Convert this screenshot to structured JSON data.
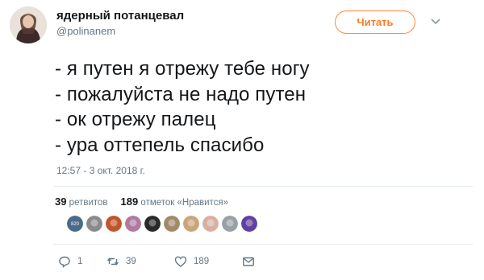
{
  "header": {
    "display_name": "ядерный потанцевал",
    "handle": "@polinanem",
    "follow_label": "Читать"
  },
  "tweet": {
    "lines": [
      "- я путен я отрежу тебе ногу",
      "- пожалуйста не надо путен",
      "- ок отрежу палец",
      "- ура оттепель спасибо"
    ],
    "timestamp": "12:57 - 3 окт. 2018 г."
  },
  "stats": {
    "retweets_count": "39",
    "retweets_label": "ретвитов",
    "likes_count": "189",
    "likes_label": "отметок «Нравится»"
  },
  "likers": [
    {
      "color": "#4a6a8a",
      "label": "820"
    },
    {
      "color": "#8a8a8a",
      "label": ""
    },
    {
      "color": "#c0552a",
      "label": ""
    },
    {
      "color": "#b07aa0",
      "label": ""
    },
    {
      "color": "#2a2a2a",
      "label": ""
    },
    {
      "color": "#a08a6a",
      "label": ""
    },
    {
      "color": "#c9a57a",
      "label": ""
    },
    {
      "color": "#d8b0a0",
      "label": ""
    },
    {
      "color": "#9aa0a8",
      "label": ""
    },
    {
      "color": "#6040a0",
      "label": ""
    }
  ],
  "actions": {
    "reply_count": "1",
    "retweet_count": "39",
    "like_count": "189"
  },
  "colors": {
    "accent": "#ff7a1f",
    "muted": "#657786",
    "divider": "#e6ecf0"
  }
}
